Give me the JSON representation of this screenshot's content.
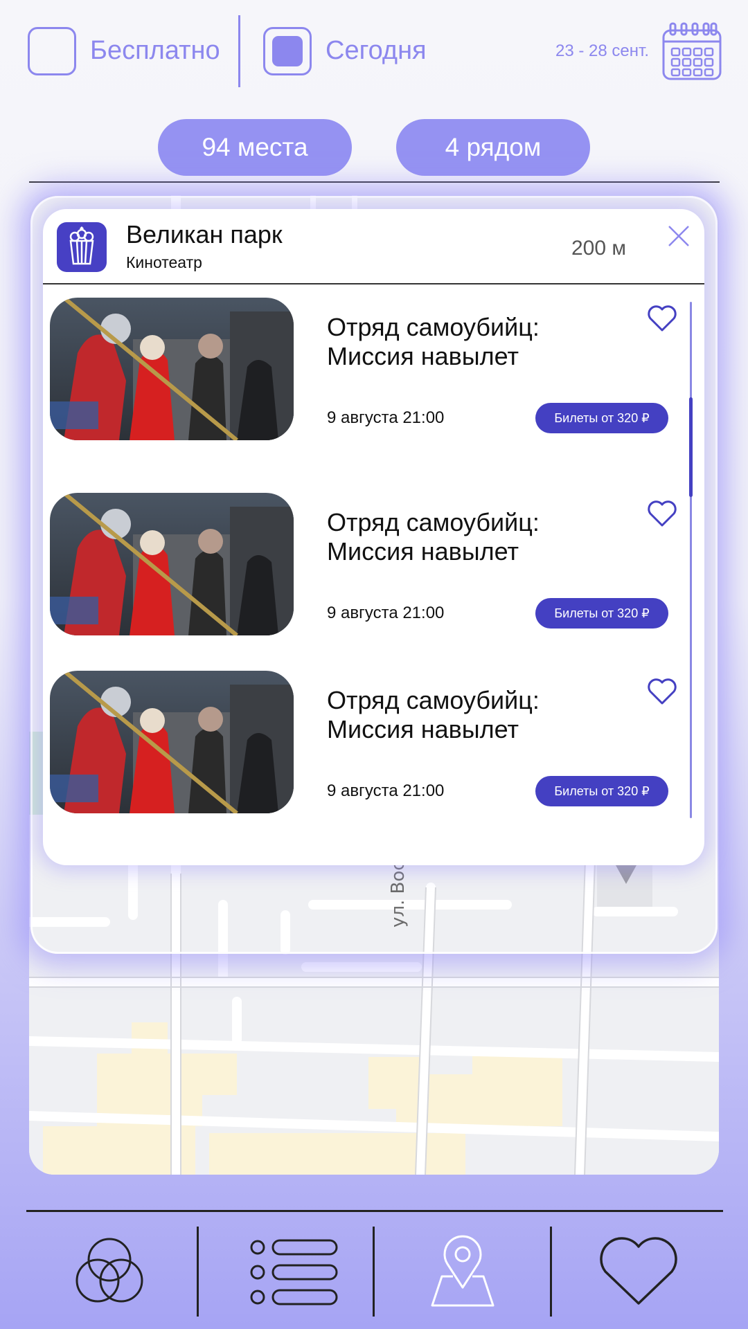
{
  "filters": {
    "free_label": "Бесплатно",
    "free_checked": false,
    "today_label": "Сегодня",
    "today_checked": true,
    "date_range": "23 - 28 сент.",
    "calendar_icon": "calendar-icon"
  },
  "pills": {
    "places": "94 места",
    "nearby": "4 рядом"
  },
  "map": {
    "street_label": "ул. Восстания"
  },
  "venue": {
    "name": "Великан парк",
    "type": "Кинотеатр",
    "distance": "200 м",
    "icon": "popcorn-icon"
  },
  "events": [
    {
      "title": "Отряд самоубийц: Миссия навылет",
      "date": "9 августа 21:00",
      "ticket_label": "Билеты от 320 ₽",
      "favorite": false
    },
    {
      "title": "Отряд самоубийц: Миссия навылет",
      "date": "9 августа 21:00",
      "ticket_label": "Билеты от 320 ₽",
      "favorite": false
    },
    {
      "title": "Отряд самоубийц: Миссия навылет",
      "date": "9 августа 21:00",
      "ticket_label": "Билеты от 320 ₽",
      "favorite": false
    }
  ],
  "nav": [
    {
      "icon": "circles-icon"
    },
    {
      "icon": "list-icon"
    },
    {
      "icon": "map-pin-icon"
    },
    {
      "icon": "heart-icon"
    }
  ],
  "colors": {
    "accent": "#8c87ee",
    "accent_dark": "#4440c2",
    "pill": "#9592f2"
  }
}
